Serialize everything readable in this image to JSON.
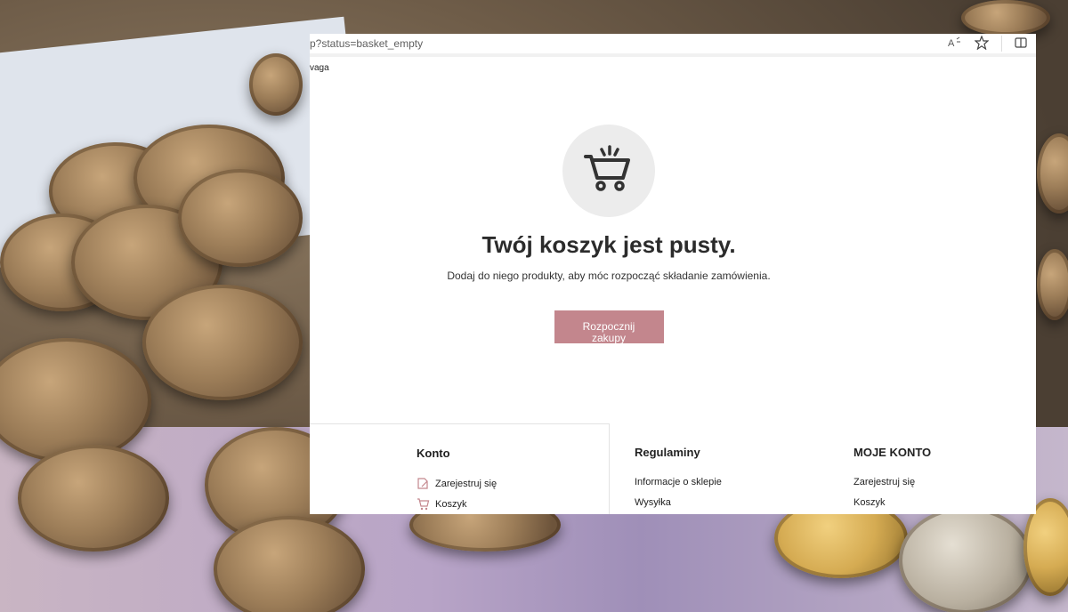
{
  "browser": {
    "url": "p?status=basket_empty",
    "breadcrumb": "vaga"
  },
  "hero": {
    "icon": "shopping-cart-icon",
    "title": "Twój koszyk jest pusty.",
    "subtitle": "Dodaj do niego produkty, aby móc rozpocząć składanie zamówienia.",
    "button_label": "Rozpocznij zakupy"
  },
  "footer": {
    "konto": {
      "heading": "Konto",
      "links": [
        {
          "label": "Zarejestruj się",
          "icon": "register-icon"
        },
        {
          "label": "Koszyk",
          "icon": "cart-icon"
        }
      ]
    },
    "regulaminy": {
      "heading": "Regulaminy",
      "links": [
        "Informacje o sklepie",
        "Wysyłka"
      ]
    },
    "moje_konto": {
      "heading": "MOJE KONTO",
      "links": [
        "Zarejestruj się",
        "Koszyk"
      ]
    }
  },
  "colors": {
    "accent": "#c3868d",
    "icon_circle": "#ececec",
    "text_dark": "#2b2b2b"
  }
}
